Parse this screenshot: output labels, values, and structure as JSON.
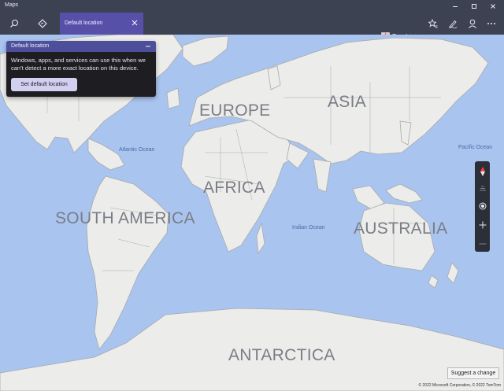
{
  "window": {
    "title": "Maps"
  },
  "toolbar": {
    "tab_label": "Default location",
    "map_style_label": "Road"
  },
  "panel": {
    "title": "Default location",
    "message": "Windows, apps, and services can use this when we can’t detect a more exact location on this device.",
    "button_label": "Set default location"
  },
  "map": {
    "continents": {
      "europe": "EUROPE",
      "asia": "ASIA",
      "africa": "AFRICA",
      "south_america": "SOUTH AMERICA",
      "australia": "AUSTRALIA",
      "antarctica": "ANTARCTICA"
    },
    "oceans": {
      "atlantic": "Atlantic Ocean",
      "pacific": "Pacific Ocean",
      "indian": "Indian Ocean"
    },
    "suggest_label": "Suggest a change",
    "copyright": "© 2022 Microsoft Corporation, © 2022 TomTom"
  },
  "colors": {
    "titlebar": "#3d4252",
    "tab": "#5750a9",
    "water": "#a9c4ef",
    "land": "#ececea",
    "border": "#a9a9a9",
    "panel_header": "#4d4f9b",
    "panel_button": "#d3cff0"
  },
  "icons": [
    "search-icon",
    "directions-icon",
    "close-icon",
    "road-map-icon",
    "chevron-down-icon",
    "favorites-icon",
    "ink-icon",
    "account-icon",
    "more-icon",
    "minimize-icon",
    "maximize-icon",
    "compass-icon",
    "tilt-icon",
    "locate-me-icon",
    "zoom-in-icon",
    "zoom-out-icon"
  ]
}
